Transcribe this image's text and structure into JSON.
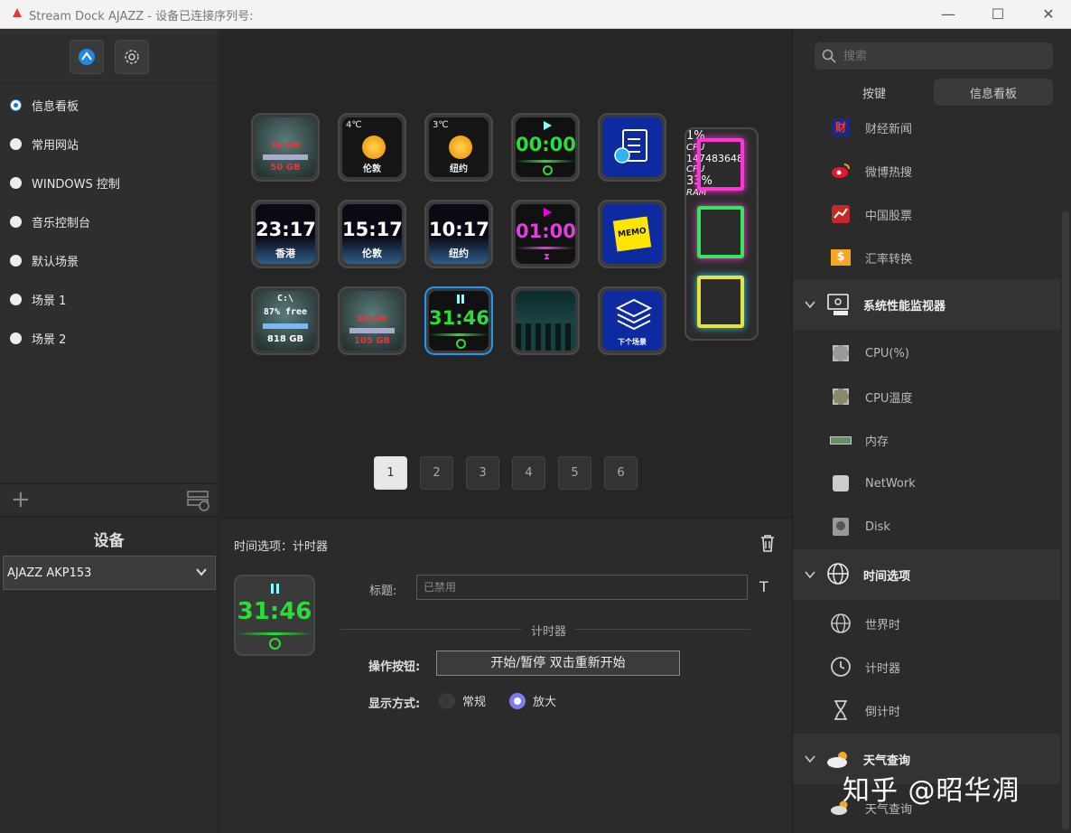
{
  "window": {
    "title": "Stream Dock AJAZZ - 设备已连接序列号:",
    "minimize": "—",
    "maximize": "☐",
    "close": "✕"
  },
  "scenes": [
    {
      "label": "信息看板",
      "selected": true
    },
    {
      "label": "常用网站",
      "selected": false
    },
    {
      "label": "WINDOWS 控制",
      "selected": false
    },
    {
      "label": "音乐控制台",
      "selected": false
    },
    {
      "label": "默认场景",
      "selected": false
    },
    {
      "label": "场景 1",
      "selected": false
    },
    {
      "label": "场景 2",
      "selected": false
    }
  ],
  "add_scene": "+",
  "device": {
    "title": "设备",
    "selected": "AJAZZ AKP153"
  },
  "keys": {
    "k1": {
      "line1": "36 GB",
      "line2": "50 GB"
    },
    "k2": {
      "temp": "4℃",
      "city": "伦敦"
    },
    "k3": {
      "temp": "3℃",
      "city": "纽约"
    },
    "k4": {
      "time": "00:00"
    },
    "k6": {
      "time": "23:17",
      "city": "香港"
    },
    "k7": {
      "time": "15:17",
      "city": "伦敦"
    },
    "k8": {
      "time": "10:17",
      "city": "纽约"
    },
    "k9": {
      "time": "01:00"
    },
    "k10": {
      "label": "MEMO"
    },
    "k11": {
      "drive": "C:\\",
      "free": "87% free",
      "size": "818 GB"
    },
    "k12": {
      "line1": "80 GB",
      "line2": "105 GB"
    },
    "k13": {
      "time": "31:46"
    },
    "k15": {
      "label": "下个场景"
    },
    "tall": {
      "cpu_pct": "1%",
      "cpu_label1": "CPU",
      "cpu_val": "147483648",
      "cpu_label2": "CPU",
      "ram_pct": "33%",
      "ram_label": "RAM"
    }
  },
  "pages": [
    "1",
    "2",
    "3",
    "4",
    "5",
    "6"
  ],
  "active_page": "1",
  "props": {
    "heading": "时间选项：计时器",
    "preview_time": "31:46",
    "title_label": "标题:",
    "title_value": "已禁用",
    "title_font_button": "T",
    "section": "计时器",
    "action_label": "操作按钮:",
    "action_value": "开始/暂停 双击重新开始",
    "display_label": "显示方式:",
    "display_options": [
      {
        "label": "常规",
        "selected": false
      },
      {
        "label": "放大",
        "selected": true
      }
    ]
  },
  "right": {
    "search_placeholder": "搜索",
    "tabs": [
      {
        "label": "按键",
        "active": false
      },
      {
        "label": "信息看板",
        "active": true
      }
    ],
    "items": {
      "finance": "财经新闻",
      "weibo": "微博热搜",
      "stocks": "中国股票",
      "fx": "汇率转换",
      "group_perf": "系统性能监视器",
      "cpu": "CPU(%)",
      "cputemp": "CPU温度",
      "mem": "内存",
      "net": "NetWork",
      "disk": "Disk",
      "group_time": "时间选项",
      "worldtime": "世界时",
      "timer": "计时器",
      "countdown": "倒计时",
      "group_weather": "天气查询",
      "weather": "天气查询"
    }
  },
  "watermark": "知乎 @昭华凋",
  "colors": {
    "accent": "#1e88e5",
    "timer_green": "#2bdc3a",
    "timer_magenta": "#e040e0",
    "radio_selected": "#7c7cf0"
  }
}
